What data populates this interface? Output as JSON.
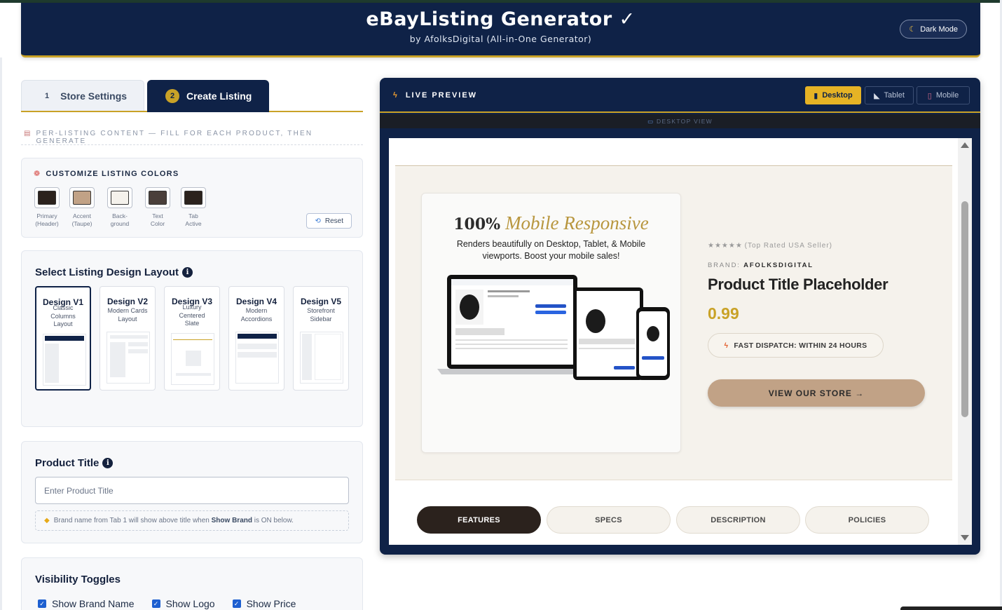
{
  "header": {
    "title": "eBayListing Generator ✓",
    "subtitle": "by AfolksDigital (All-in-One Generator)",
    "dark_mode_label": "Dark Mode"
  },
  "tabs": [
    {
      "num": "1",
      "label": "Store Settings"
    },
    {
      "num": "2",
      "label": "Create Listing"
    }
  ],
  "per_listing_note": "PER-LISTING CONTENT — FILL FOR EACH PRODUCT, THEN GENERATE",
  "colors": {
    "title": "CUSTOMIZE LISTING COLORS",
    "reset_label": "Reset",
    "swatches": [
      {
        "l1": "Primary",
        "l2": "(Header)",
        "color": "#2b221d"
      },
      {
        "l1": "Accent",
        "l2": "(Taupe)",
        "color": "#c1a286"
      },
      {
        "l1": "Back-",
        "l2": "ground",
        "color": "#f5f2ec"
      },
      {
        "l1": "Text",
        "l2": "Color",
        "color": "#4a3f3a"
      },
      {
        "l1": "Tab",
        "l2": "Active",
        "color": "#2b221d"
      }
    ]
  },
  "layout": {
    "title": "Select Listing Design Layout",
    "designs": [
      {
        "name": "Design V1",
        "d1": "Classic",
        "d2": "Columns",
        "d3": "Layout"
      },
      {
        "name": "Design V2",
        "d1": "Modern Cards",
        "d2": "Layout",
        "d3": ""
      },
      {
        "name": "Design V3",
        "d1": "Luxury",
        "d2": "Centered",
        "d3": "Slate"
      },
      {
        "name": "Design V4",
        "d1": "Modern",
        "d2": "Accordions",
        "d3": ""
      },
      {
        "name": "Design V5",
        "d1": "Storefront",
        "d2": "Sidebar",
        "d3": ""
      }
    ]
  },
  "product_title": {
    "label": "Product Title",
    "placeholder": "Enter Product Title",
    "hint_pre": "Brand name from Tab 1 will show above title when",
    "hint_bold": "Show Brand",
    "hint_post": "is ON below."
  },
  "visibility": {
    "title": "Visibility Toggles",
    "items": [
      "Show Brand Name",
      "Show Logo",
      "Show Price"
    ]
  },
  "preview": {
    "title": "LIVE PREVIEW",
    "devices": [
      "Desktop",
      "Tablet",
      "Mobile"
    ],
    "view_label": "DESKTOP VIEW",
    "image_heading_1": "100%",
    "image_heading_2": "Mobile Responsive",
    "image_text_1": "Renders beautifully on Desktop, Tablet, & Mobile",
    "image_text_2": "viewports. Boost your mobile sales!",
    "stars": "★★★★★",
    "rating_text": "(Top Rated USA Seller)",
    "brand_label": "BRAND:",
    "brand_value": "AFOLKSDIGITAL",
    "product_title": "Product Title Placeholder",
    "price": "0.99",
    "dispatch": "FAST DISPATCH: WITHIN 24 HOURS",
    "store_button": "VIEW OUR STORE →",
    "tabs": [
      "FEATURES",
      "SPECS",
      "DESCRIPTION",
      "POLICIES"
    ]
  },
  "palette": {
    "navy": "#0f2247",
    "gold": "#c9a227",
    "taupe": "#c1a286"
  }
}
